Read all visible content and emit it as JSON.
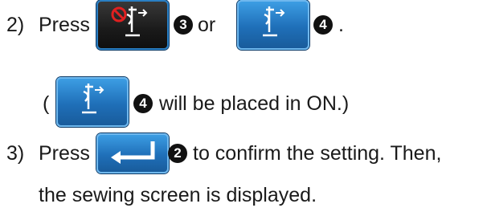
{
  "steps": {
    "step2": {
      "num_label": "2)",
      "press_text": "Press",
      "badge_a": "3",
      "or_text": "or",
      "badge_b": "4",
      "end_text": "."
    },
    "note": {
      "open_paren": "(",
      "badge": "4",
      "text": "will be placed in ON.)"
    },
    "step3": {
      "num_label": "3)",
      "press_text": "Press",
      "badge": "2",
      "text": "to confirm the setting. Then,",
      "continuation": "the sewing screen is displayed."
    }
  },
  "icons": {
    "thread_off_button": "thread-trimmer-off-icon",
    "thread_on_button": "thread-trimmer-on-icon",
    "enter_button": "enter-key-icon"
  },
  "colors": {
    "button_blue": "#1f6fb8",
    "button_dark": "#1a1a1a",
    "prohibit_red": "#e02020"
  }
}
